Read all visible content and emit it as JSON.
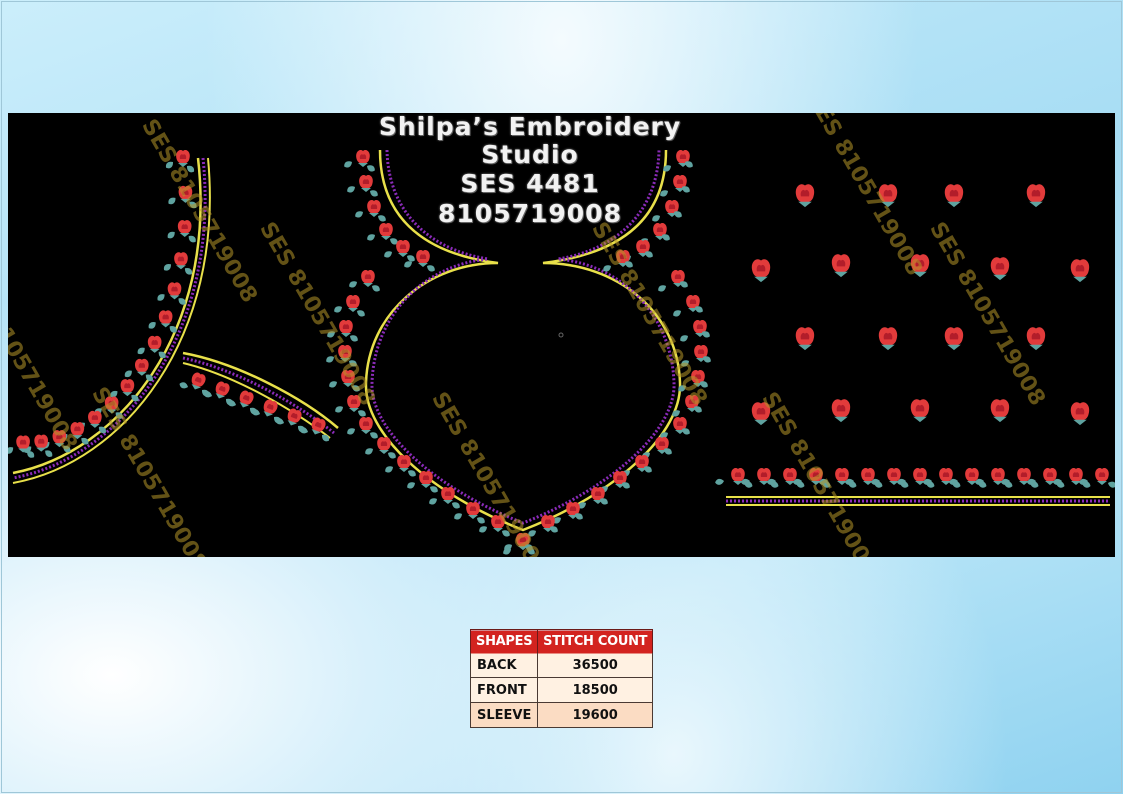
{
  "header": {
    "studio_name": "Shilpa’s Embroidery Studio",
    "design_code": "SES 4481",
    "phone": "8105719008"
  },
  "watermark": {
    "text": "SES 8105719008"
  },
  "colors": {
    "background_panel": "#000000",
    "motif_red": "#e23b3b",
    "leaf_teal": "#5fa3a0",
    "outline_yellow": "#e8e04a",
    "stitch_purple": "#8a2bb8",
    "table_header": "#d3231f",
    "table_cell": "#fff1e2"
  },
  "stitch_table": {
    "columns": [
      "SHAPES",
      "STITCH COUNT"
    ],
    "rows": [
      {
        "shape": "BACK",
        "count": "36500"
      },
      {
        "shape": "FRONT",
        "count": "18500"
      },
      {
        "shape": "SLEEVE",
        "count": "19600"
      }
    ]
  }
}
